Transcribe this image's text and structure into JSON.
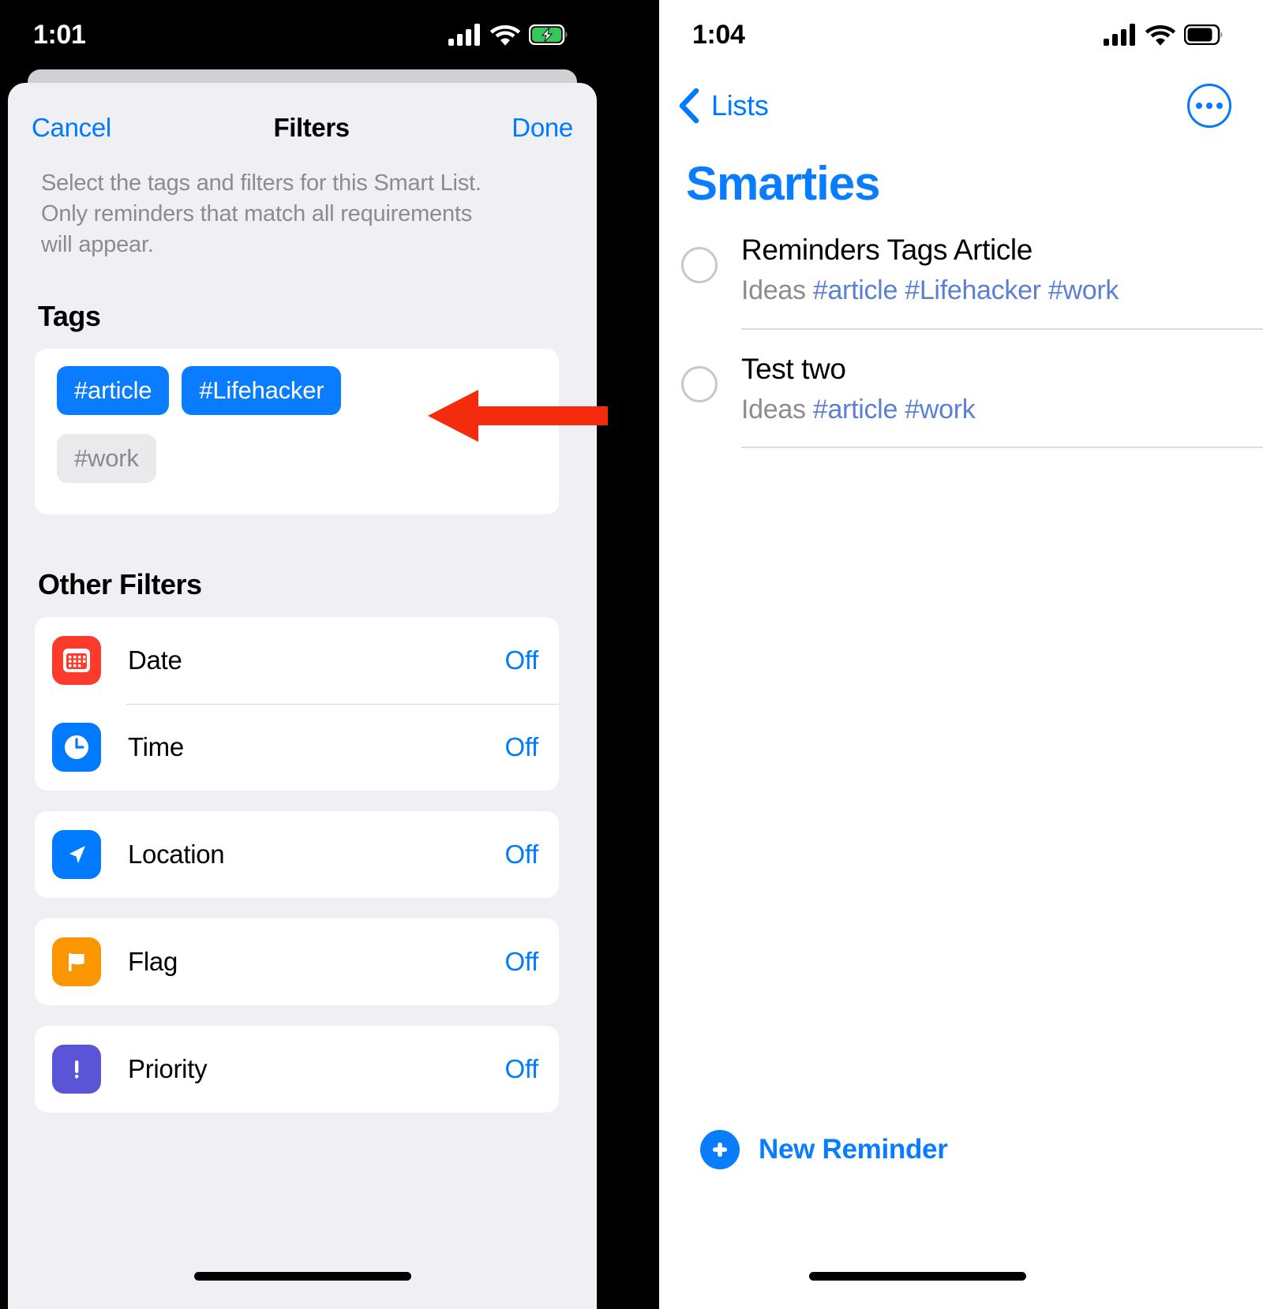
{
  "left_phone": {
    "status_bar": {
      "time": "1:01",
      "icons": [
        "cellular-signal-icon",
        "wifi-icon",
        "battery-charging-icon"
      ],
      "battery_state": "charging",
      "battery_color": "#34c759"
    },
    "sheet": {
      "cancel_label": "Cancel",
      "title": "Filters",
      "done_label": "Done",
      "description": "Select the tags and filters for this Smart List. Only reminders that match all requirements will appear.",
      "tags_section": {
        "heading": "Tags",
        "tags": [
          {
            "label": "#article",
            "selected": true
          },
          {
            "label": "#Lifehacker",
            "selected": true
          },
          {
            "label": "#work",
            "selected": false
          }
        ]
      },
      "other_filters_section": {
        "heading": "Other Filters",
        "groups": [
          {
            "rows": [
              {
                "icon": "calendar-icon",
                "icon_color": "#fc3b2d",
                "label": "Date",
                "value": "Off"
              },
              {
                "icon": "clock-icon",
                "icon_color": "#007aff",
                "label": "Time",
                "value": "Off"
              }
            ]
          },
          {
            "rows": [
              {
                "icon": "location-arrow-icon",
                "icon_color": "#007aff",
                "label": "Location",
                "value": "Off"
              }
            ]
          },
          {
            "rows": [
              {
                "icon": "flag-icon",
                "icon_color": "#fb9600",
                "label": "Flag",
                "value": "Off"
              }
            ]
          },
          {
            "rows": [
              {
                "icon": "exclamation-icon",
                "icon_color": "#5a55d6",
                "label": "Priority",
                "value": "Off"
              }
            ]
          }
        ]
      }
    }
  },
  "right_phone": {
    "status_bar": {
      "time": "1:04",
      "icons": [
        "cellular-signal-icon",
        "wifi-icon",
        "battery-icon"
      ],
      "battery_state": "full",
      "battery_color": "#000000"
    },
    "nav": {
      "back_label": "Lists",
      "back_icon": "chevron-left-icon",
      "more_icon": "more-options-icon"
    },
    "list_title": "Smarties",
    "list_title_color": "#0a7cff",
    "reminders": [
      {
        "title": "Reminders Tags Article",
        "list_name": "Ideas",
        "tags": [
          "#article",
          "#Lifehacker",
          "#work"
        ],
        "completed": false
      },
      {
        "title": "Test two",
        "list_name": "Ideas",
        "tags": [
          "#article",
          "#work"
        ],
        "completed": false
      }
    ],
    "new_reminder": {
      "label": "New Reminder",
      "icon": "plus-circle-icon"
    }
  },
  "annotation": {
    "arrow": {
      "color": "#f42b0c",
      "direction": "left",
      "points_at": "#Lifehacker"
    }
  },
  "colors": {
    "accent_blue": "#007aff",
    "tag_blue": "#0a7cff",
    "sheet_bg": "#f0f0f4",
    "card_bg": "#ffffff",
    "secondary_text": "#8b8b90",
    "annotation_red": "#f42b0c"
  }
}
